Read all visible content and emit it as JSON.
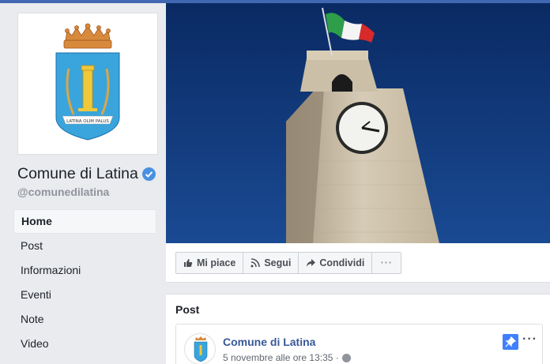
{
  "page": {
    "name": "Comune di Latina",
    "handle": "@comunedilatina",
    "crest_motto": "LATINA OLIM PALUS"
  },
  "sidebar": {
    "items": [
      {
        "label": "Home",
        "active": true
      },
      {
        "label": "Post",
        "active": false
      },
      {
        "label": "Informazioni",
        "active": false
      },
      {
        "label": "Eventi",
        "active": false
      },
      {
        "label": "Note",
        "active": false
      },
      {
        "label": "Video",
        "active": false
      }
    ]
  },
  "actions": {
    "like": "Mi piace",
    "follow": "Segui",
    "share": "Condividi",
    "more": "···"
  },
  "posts": {
    "title": "Post",
    "first": {
      "author": "Comune di Latina",
      "date": "5 novembre alle ore 13:35 ·",
      "more": "···"
    }
  },
  "colors": {
    "brand_blue": "#4267b2",
    "link_blue": "#385898",
    "verified_blue": "#4a90e2",
    "pin_blue": "#4080ff",
    "sky": "#0c2f6e"
  },
  "icons": [
    "verified-badge-icon",
    "like-icon",
    "rss-icon",
    "share-icon",
    "pin-icon",
    "globe-icon",
    "more-icon"
  ]
}
